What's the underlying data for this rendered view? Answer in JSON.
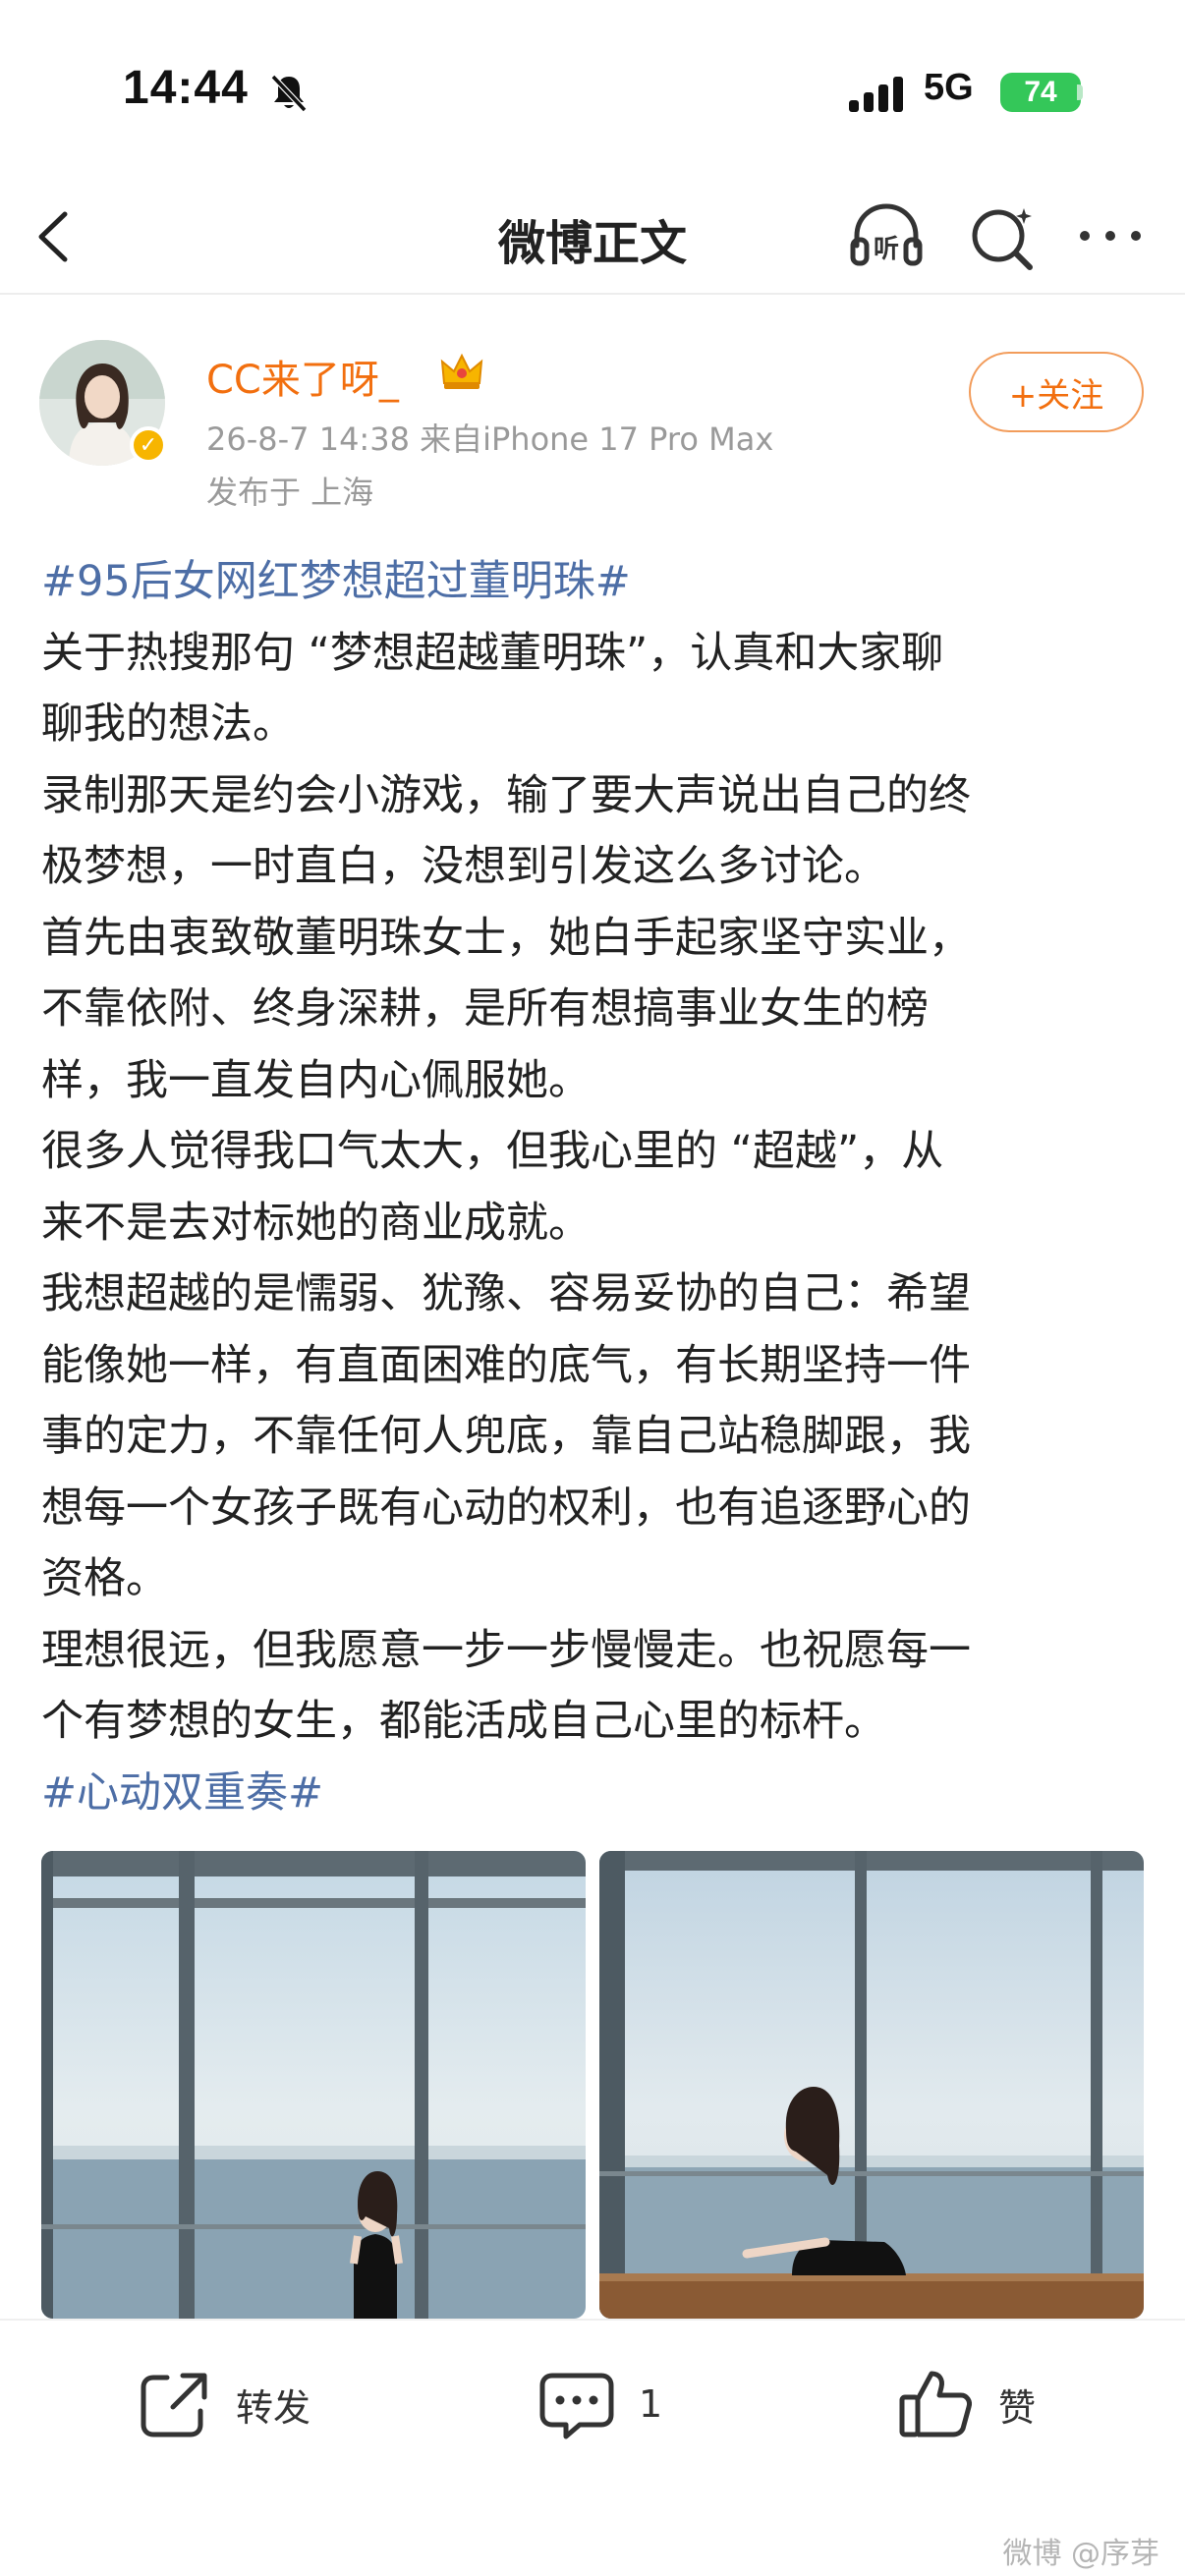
{
  "status_bar": {
    "time": "14:44",
    "network": "5G",
    "battery": "74"
  },
  "nav": {
    "title": "微博正文"
  },
  "author": {
    "name": "CC来了呀_",
    "meta": "26-8-7 14:38  来自iPhone 17 Pro Max",
    "location": "发布于 上海",
    "follow_label": "+关注"
  },
  "post": {
    "tag_top": "#95后女网红梦想超过董明珠#",
    "lines": [
      "关于热搜那句 “梦想超越董明珠”，认真和大家聊",
      "聊我的想法。",
      "录制那天是约会小游戏，输了要大声说出自己的终",
      "极梦想，一时直白，没想到引发这么多讨论。",
      "首先由衷致敬董明珠女士，她白手起家坚守实业，",
      "不靠依附、终身深耕，是所有想搞事业女生的榜",
      "样，我一直发自内心佩服她。",
      "很多人觉得我口气太大，但我心里的 “超越”，从",
      "来不是去对标她的商业成就。",
      "我想超越的是懦弱、犹豫、容易妥协的自己：希望",
      "能像她一样，有直面困难的底气，有长期坚持一件",
      "事的定力，不靠任何人兜底，靠自己站稳脚跟，我",
      "想每一个女孩子既有心动的权利，也有追逐野心的",
      "资格。",
      "理想很远，但我愿意一步一步慢慢走。也祝愿每一",
      "个有梦想的女生，都能活成自己心里的标杆。"
    ],
    "tag_bottom": "#心动双重奏#"
  },
  "actions": {
    "repost_label": "转发",
    "comment_count": "1",
    "like_label": "赞"
  },
  "watermark": "微博 @序芽",
  "colors": {
    "accent": "#f26f0f",
    "hashtag": "#4d6ea6",
    "verified": "#f7b500",
    "battery": "#34c759"
  }
}
